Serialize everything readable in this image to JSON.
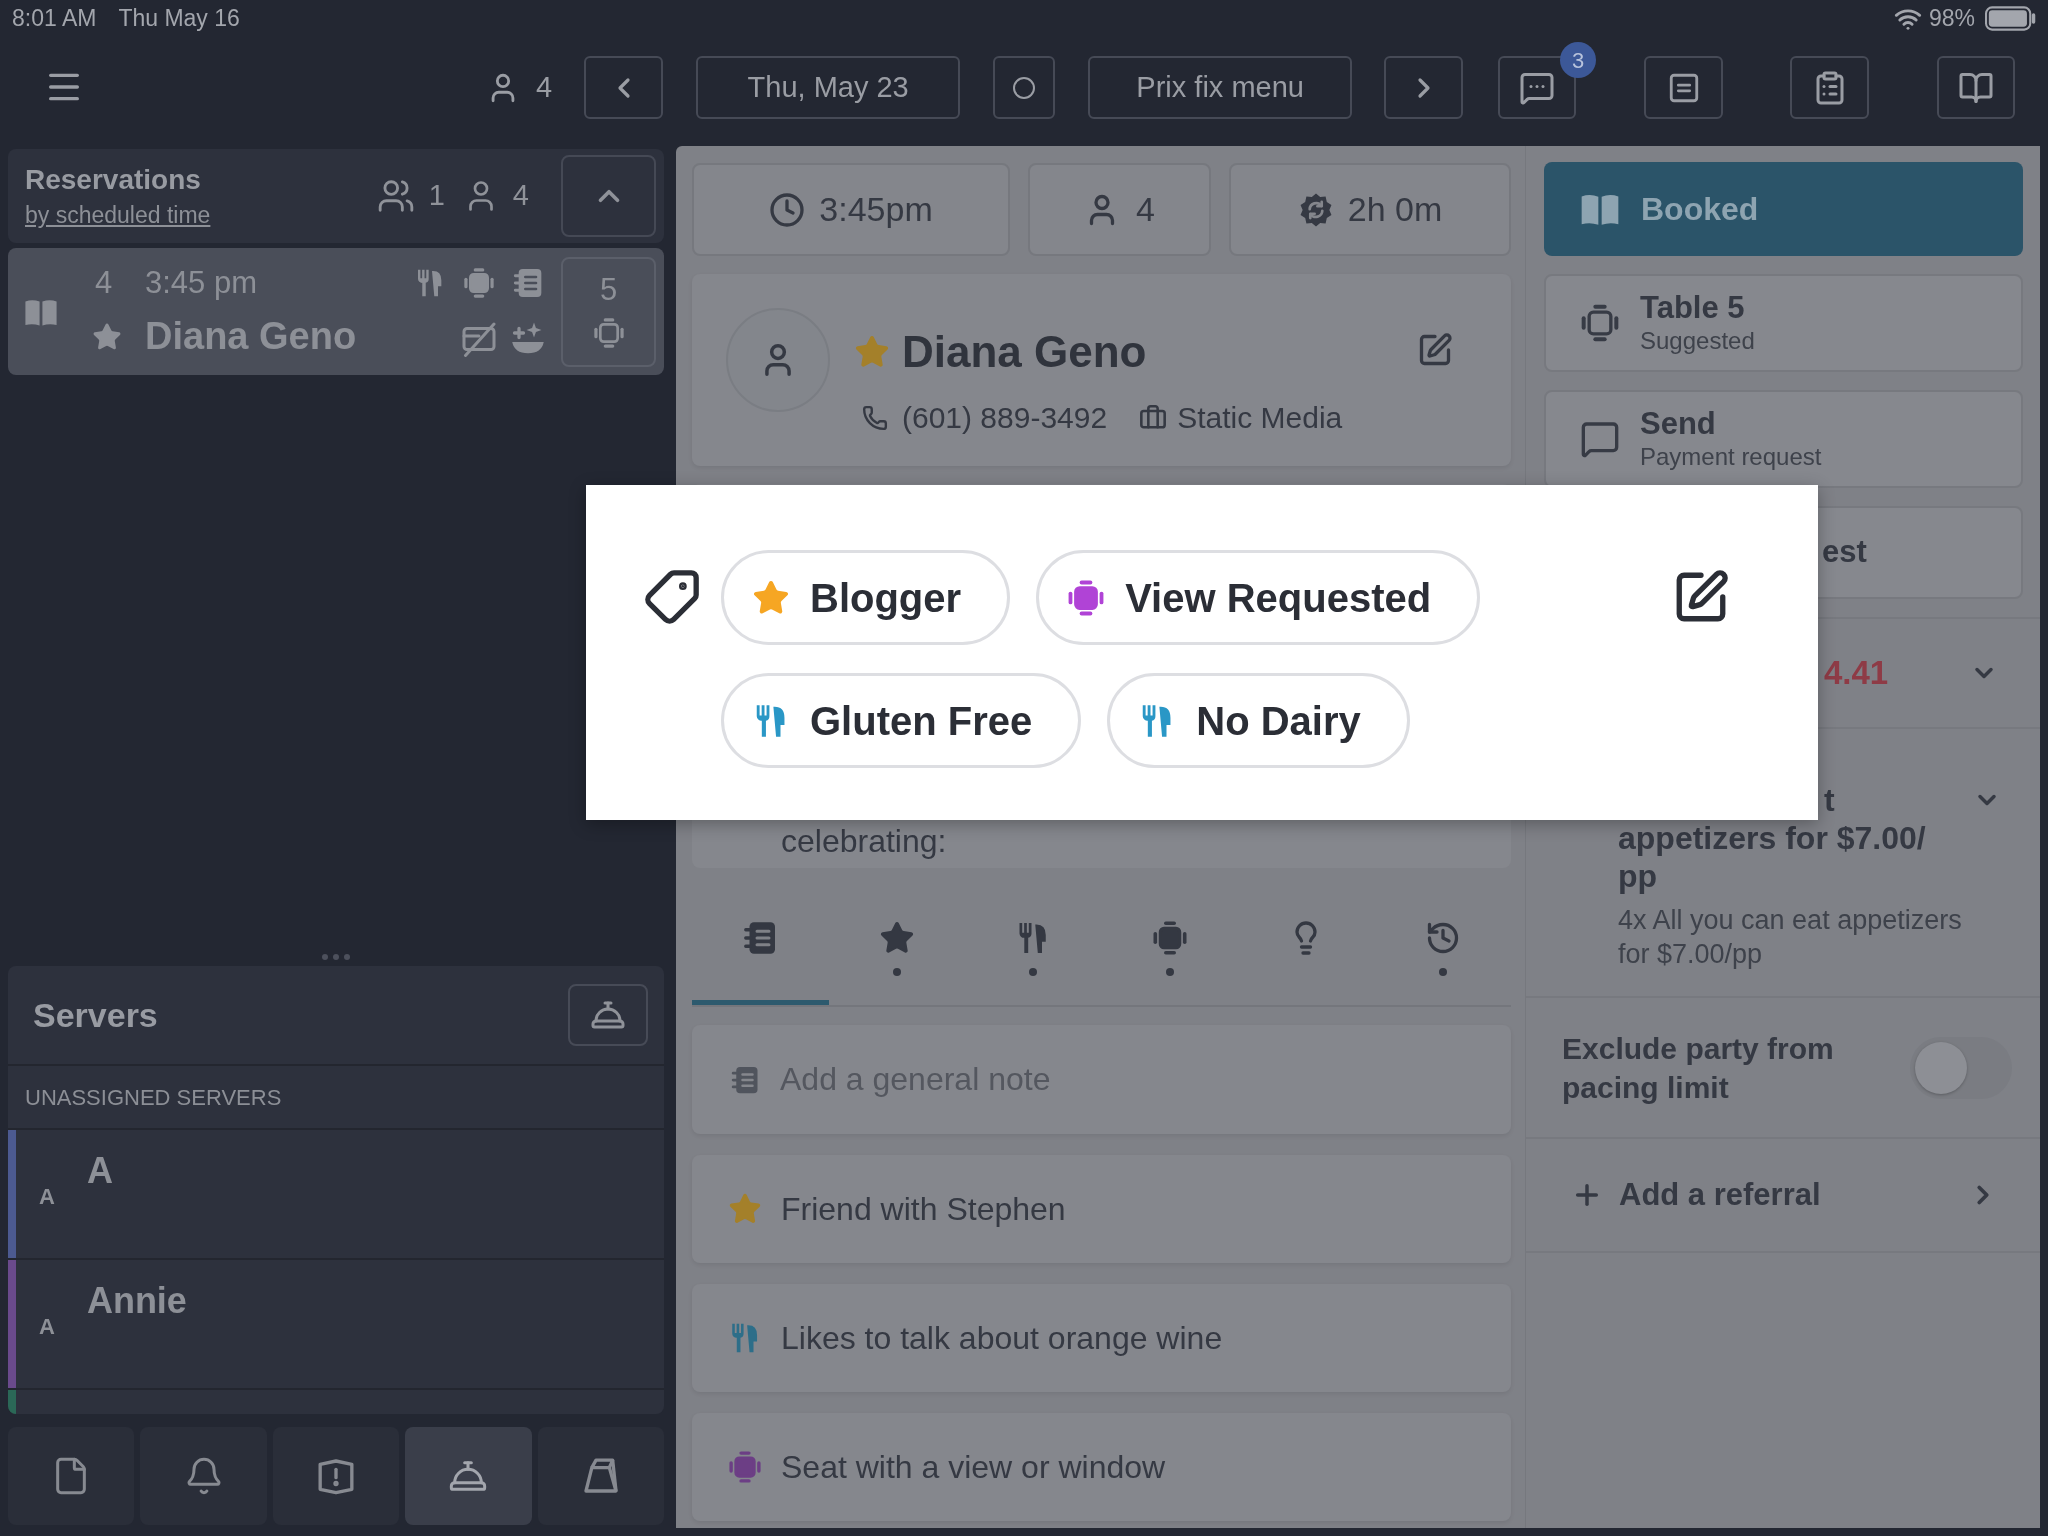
{
  "status_bar": {
    "time": "8:01 AM",
    "date": "Thu May 16",
    "battery": "98%"
  },
  "toolbar": {
    "party_count": "4",
    "date": "Thu, May 23",
    "menu": "Prix fix menu",
    "messages_badge": "3"
  },
  "reservations": {
    "title": "Reservations",
    "sort": "by scheduled time",
    "group_count": "1",
    "cover_count": "4",
    "rows": [
      {
        "party_size": "4",
        "time": "3:45 pm",
        "name": "Diana Geno",
        "table": "5",
        "selected": true
      }
    ]
  },
  "servers": {
    "title": "Servers",
    "section": "UNASSIGNED SERVERS",
    "items": [
      {
        "initial": "A",
        "name": "A",
        "color": "#4c5a90"
      },
      {
        "initial": "A",
        "name": "Annie",
        "color": "#6a4a8c"
      },
      {
        "color": "#2b6857"
      }
    ]
  },
  "bottom_tabs": [
    {
      "kind": "document",
      "selected": false
    },
    {
      "kind": "bell",
      "selected": false
    },
    {
      "kind": "alert",
      "selected": false
    },
    {
      "kind": "service",
      "selected": true
    },
    {
      "kind": "prism",
      "selected": false
    }
  ],
  "detail": {
    "time": "3:45pm",
    "party_size": "4",
    "duration": "2h 0m",
    "guest": {
      "name": "Diana Geno",
      "phone": "(601) 889-3492",
      "company": "Static Media"
    },
    "note_fragment": "celebrating:",
    "note_tabs": [
      {
        "kind": "notes",
        "selected": true,
        "has_entries": false
      },
      {
        "kind": "favorites",
        "selected": false,
        "has_entries": true
      },
      {
        "kind": "dining",
        "selected": false,
        "has_entries": true
      },
      {
        "kind": "seating",
        "selected": false,
        "has_entries": true
      },
      {
        "kind": "ideas",
        "selected": false,
        "has_entries": false
      },
      {
        "kind": "history",
        "selected": false,
        "has_entries": true
      }
    ],
    "general_note": {
      "placeholder": "Add a general note"
    },
    "notes": [
      {
        "kind": "favorites",
        "text": "Friend with Stephen"
      },
      {
        "kind": "dining",
        "text": "Likes to talk about orange wine"
      },
      {
        "kind": "seating",
        "text": "Seat with a view or window"
      }
    ]
  },
  "side": {
    "status": "Booked",
    "actions": [
      {
        "kind": "table",
        "title": "Table 5",
        "subtitle": "Suggested"
      },
      {
        "kind": "payment",
        "title": "Send",
        "subtitle": "Payment request"
      }
    ],
    "action_fragment": "est",
    "spend_fragment": "4.41",
    "offer": {
      "title_lines": [
        "t",
        "appetizers for $7.00/",
        "pp"
      ],
      "description": "4x All you can eat appetizers for $7.00/pp"
    },
    "pacing": {
      "label": "Exclude party from pacing limit",
      "on": false
    },
    "referral": "Add a referral"
  },
  "tags_dialog": {
    "tags": [
      {
        "kind": "favorites",
        "label": "Blogger"
      },
      {
        "kind": "seating",
        "label": "View Requested"
      },
      {
        "kind": "dining",
        "label": "Gluten Free"
      },
      {
        "kind": "dining",
        "label": "No Dairy"
      }
    ]
  }
}
